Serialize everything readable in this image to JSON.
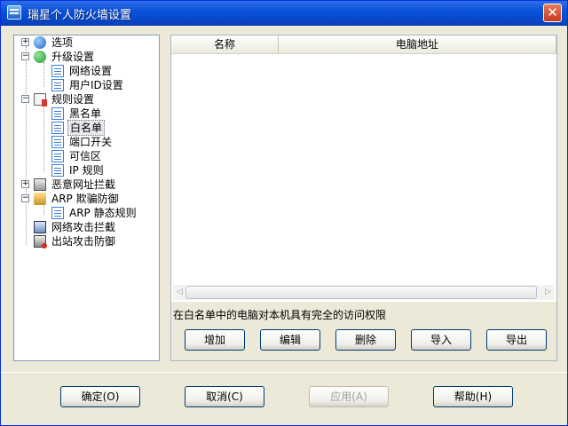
{
  "window": {
    "title": "瑞星个人防火墙设置",
    "close_symbol": "✕"
  },
  "tree": {
    "items": [
      {
        "label": "选项",
        "expander": "+"
      },
      {
        "label": "升级设置",
        "expander": "−"
      },
      {
        "label": "网络设置"
      },
      {
        "label": "用户ID设置"
      },
      {
        "label": "规则设置",
        "expander": "−"
      },
      {
        "label": "黑名单"
      },
      {
        "label": "白名单",
        "selected": true
      },
      {
        "label": "端口开关"
      },
      {
        "label": "可信区"
      },
      {
        "label": "IP 规则"
      },
      {
        "label": "恶意网址拦截",
        "expander": "+"
      },
      {
        "label": "ARP 欺骗防御",
        "expander": "−"
      },
      {
        "label": "ARP 静态规则"
      },
      {
        "label": "网络攻击拦截"
      },
      {
        "label": "出站攻击防御"
      }
    ]
  },
  "list": {
    "columns": [
      "名称",
      "电脑地址"
    ],
    "scroll_left": "◁",
    "scroll_right": "▷"
  },
  "info_text": "在白名单中的电脑对本机具有完全的访问权限",
  "actions": {
    "add": "增加",
    "edit": "编辑",
    "delete": "删除",
    "import": "导入",
    "export": "导出"
  },
  "footer": {
    "ok": "确定(O)",
    "cancel": "取消(C)",
    "apply": "应用(A)",
    "help": "帮助(H)"
  },
  "icons": {
    "app": "shield-icon",
    "options": "options-icon",
    "update": "update-icon",
    "rules": "rules-icon",
    "document": "document-icon",
    "malicious_url": "url-block-icon",
    "arp": "arp-icon",
    "network_attack": "network-attack-icon",
    "outbound": "outbound-icon"
  },
  "colors": {
    "titlebar": "#0a52d8",
    "window_bg": "#ece9d8",
    "panel_border": "#7f9db9"
  }
}
